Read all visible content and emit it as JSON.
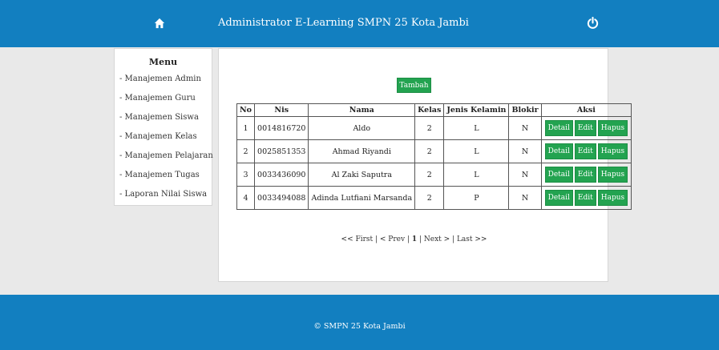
{
  "header": {
    "title": "Administrator E-Learning SMPN 25 Kota Jambi",
    "home_icon": "home-icon",
    "power_icon": "power-icon",
    "bg_color": "#127fc0"
  },
  "menu": {
    "title": "Menu",
    "items": [
      {
        "label": "- Manajemen Admin"
      },
      {
        "label": "- Manajemen Guru"
      },
      {
        "label": "- Manajemen Siswa"
      },
      {
        "label": "- Manajemen Kelas"
      },
      {
        "label": "- Manajemen Pelajaran"
      },
      {
        "label": "- Manajemen Tugas"
      },
      {
        "label": "- Laporan Nilai Siswa"
      }
    ]
  },
  "main": {
    "add_label": "Tambah",
    "columns": [
      "No",
      "Nis",
      "Nama",
      "Kelas",
      "Jenis Kelamin",
      "Blokir",
      "Aksi"
    ],
    "rows": [
      {
        "no": "1",
        "nis": "0014816720",
        "nama": "Aldo",
        "kelas": "2",
        "jk": "L",
        "blokir": "N"
      },
      {
        "no": "2",
        "nis": "0025851353",
        "nama": "Ahmad Riyandi",
        "kelas": "2",
        "jk": "L",
        "blokir": "N"
      },
      {
        "no": "3",
        "nis": "0033436090",
        "nama": "Al Zaki Saputra",
        "kelas": "2",
        "jk": "L",
        "blokir": "N"
      },
      {
        "no": "4",
        "nis": "0033494088",
        "nama": "Adinda Lutfiani Marsanda",
        "kelas": "2",
        "jk": "P",
        "blokir": "N"
      }
    ],
    "actions": {
      "detail": "Detail",
      "edit": "Edit",
      "delete": "Hapus"
    },
    "button_color": "#23a350"
  },
  "pagination": {
    "first": "<< First",
    "sep1": " | ",
    "prev": "< Prev",
    "sep2": " | ",
    "current": "1",
    "sep3": " | ",
    "next": "Next >",
    "sep4": " | ",
    "last": "Last >>"
  },
  "footer": {
    "copyright": "© SMPN 25 Kota Jambi"
  }
}
